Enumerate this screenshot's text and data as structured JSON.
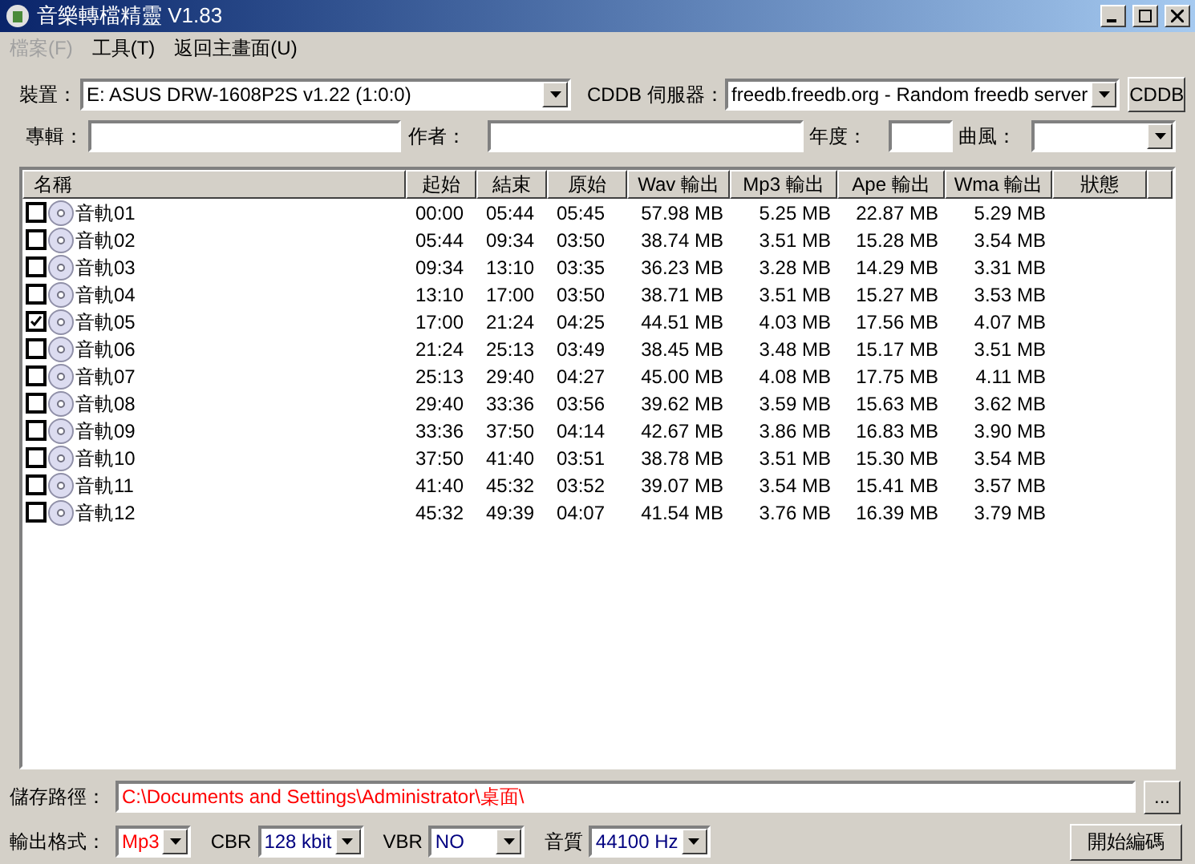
{
  "window": {
    "title": "音樂轉檔精靈 V1.83"
  },
  "menu": [
    {
      "label": "檔案(F)",
      "disabled": true
    },
    {
      "label": "工具(T)",
      "disabled": false
    },
    {
      "label": "返回主畫面(U)",
      "disabled": false
    }
  ],
  "device": {
    "label": "裝置：",
    "value": "E: ASUS DRW-1608P2S v1.22 (1:0:0)"
  },
  "cddb": {
    "label": "CDDB 伺服器：",
    "value": "freedb.freedb.org - Random freedb server",
    "button": "CDDB"
  },
  "info_fields": [
    {
      "label": "專輯：",
      "kind": "text"
    },
    {
      "label": "作者：",
      "kind": "text"
    },
    {
      "label": "年度：",
      "kind": "text"
    },
    {
      "label": "曲風：",
      "kind": "select"
    }
  ],
  "table": {
    "columns": [
      "名稱",
      "起始",
      "結束",
      "原始",
      "Wav 輸出",
      "Mp3 輸出",
      "Ape 輸出",
      "Wma 輸出",
      "狀態"
    ],
    "rows": [
      {
        "checked": false,
        "cells": [
          "音軌01",
          "00:00",
          "05:44",
          "05:45",
          "57.98 MB",
          "5.25 MB",
          "22.87 MB",
          "5.29 MB"
        ]
      },
      {
        "checked": false,
        "cells": [
          "音軌02",
          "05:44",
          "09:34",
          "03:50",
          "38.74 MB",
          "3.51 MB",
          "15.28 MB",
          "3.54 MB"
        ]
      },
      {
        "checked": false,
        "cells": [
          "音軌03",
          "09:34",
          "13:10",
          "03:35",
          "36.23 MB",
          "3.28 MB",
          "14.29 MB",
          "3.31 MB"
        ]
      },
      {
        "checked": false,
        "cells": [
          "音軌04",
          "13:10",
          "17:00",
          "03:50",
          "38.71 MB",
          "3.51 MB",
          "15.27 MB",
          "3.53 MB"
        ]
      },
      {
        "checked": true,
        "cells": [
          "音軌05",
          "17:00",
          "21:24",
          "04:25",
          "44.51 MB",
          "4.03 MB",
          "17.56 MB",
          "4.07 MB"
        ]
      },
      {
        "checked": false,
        "cells": [
          "音軌06",
          "21:24",
          "25:13",
          "03:49",
          "38.45 MB",
          "3.48 MB",
          "15.17 MB",
          "3.51 MB"
        ]
      },
      {
        "checked": false,
        "cells": [
          "音軌07",
          "25:13",
          "29:40",
          "04:27",
          "45.00 MB",
          "4.08 MB",
          "17.75 MB",
          "4.11 MB"
        ]
      },
      {
        "checked": false,
        "cells": [
          "音軌08",
          "29:40",
          "33:36",
          "03:56",
          "39.62 MB",
          "3.59 MB",
          "15.63 MB",
          "3.62 MB"
        ]
      },
      {
        "checked": false,
        "cells": [
          "音軌09",
          "33:36",
          "37:50",
          "04:14",
          "42.67 MB",
          "3.86 MB",
          "16.83 MB",
          "3.90 MB"
        ]
      },
      {
        "checked": false,
        "cells": [
          "音軌10",
          "37:50",
          "41:40",
          "03:51",
          "38.78 MB",
          "3.51 MB",
          "15.30 MB",
          "3.54 MB"
        ]
      },
      {
        "checked": false,
        "cells": [
          "音軌11",
          "41:40",
          "45:32",
          "03:52",
          "39.07 MB",
          "3.54 MB",
          "15.41 MB",
          "3.57 MB"
        ]
      },
      {
        "checked": false,
        "cells": [
          "音軌12",
          "45:32",
          "49:39",
          "04:07",
          "41.54 MB",
          "3.76 MB",
          "16.39 MB",
          "3.79 MB"
        ]
      }
    ]
  },
  "save_path": {
    "label": "儲存路徑：",
    "value": "C:\\Documents and Settings\\Administrator\\桌面\\",
    "button": "..."
  },
  "output_options": [
    {
      "label": "輸出格式：",
      "value": "Mp3",
      "color": "#ff0000"
    },
    {
      "label": "CBR",
      "value": "128 kbit",
      "color": "#000080"
    },
    {
      "label": "VBR",
      "value": "NO",
      "color": "#000080"
    },
    {
      "label": "音質",
      "value": "44100 Hz",
      "color": "#000080"
    }
  ],
  "encode_button": "開始編碼"
}
